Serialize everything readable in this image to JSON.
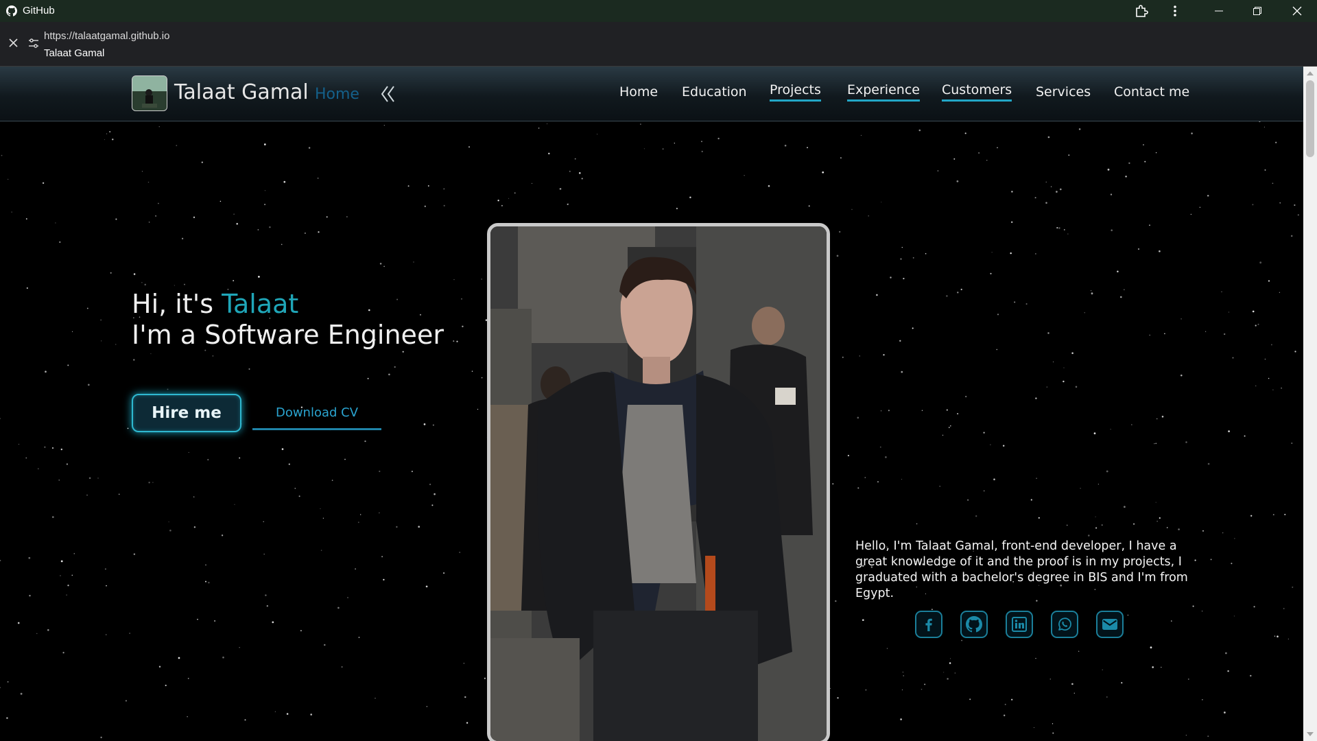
{
  "window": {
    "app_title": "GitHub",
    "icons": [
      "github-logo-icon",
      "extensions-icon",
      "more-options-icon",
      "minimize-icon",
      "restore-icon",
      "close-icon"
    ]
  },
  "urlbar": {
    "url": "https://talaatgamal.github.io",
    "page_title": "Talaat Gamal"
  },
  "header": {
    "brand_name": "Talaat Gamal",
    "brand_sub": "Home",
    "nav": [
      {
        "label": "Home",
        "underlined": false
      },
      {
        "label": "Education",
        "underlined": false
      },
      {
        "label": "Projects",
        "underlined": true
      },
      {
        "label": "Experience",
        "underlined": true
      },
      {
        "label": "Customers",
        "underlined": true
      },
      {
        "label": "Services",
        "underlined": false
      },
      {
        "label": "Contact me",
        "underlined": false
      }
    ]
  },
  "hero": {
    "greeting": "Hi, it's ",
    "name": "Talaat",
    "role": "I'm a Software Engineer",
    "hire_label": "Hire me",
    "download_label": "Download CV"
  },
  "about": {
    "text": "Hello, I'm Talaat Gamal, front-end developer, I have a great knowledge of it and the proof is in my projects, I graduated with a bachelor's degree in BIS and I'm from Egypt."
  },
  "socials": [
    "facebook-icon",
    "github-icon",
    "linkedin-icon",
    "whatsapp-icon",
    "email-icon"
  ],
  "colors": {
    "accent": "#1fa6b8",
    "brand_sub": "#14608a",
    "underline": "#22a7c7",
    "titlebar": "#1b2a20",
    "background": "#000000"
  }
}
